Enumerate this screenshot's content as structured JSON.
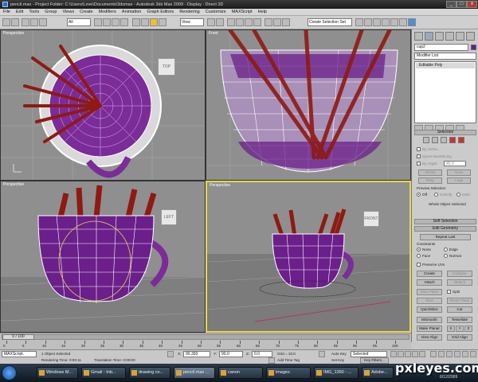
{
  "window": {
    "title": "pencil.max    - Project Folder: C:\\Users\\Love\\Documents\\3dsmax    - Autodesk 3ds Max 2009    - Display : Direct 3D",
    "buttons": [
      "_",
      "□",
      "x"
    ]
  },
  "menu": [
    "File",
    "Edit",
    "Tools",
    "Group",
    "Views",
    "Create",
    "Modifiers",
    "Animation",
    "Graph Editors",
    "Rendering",
    "Customize",
    "MAXScript",
    "Help"
  ],
  "toolbar": {
    "filter_value": "All",
    "refcoord_value": "View",
    "selection_set_placeholder": "Create Selection Set"
  },
  "viewports": [
    {
      "label": "Perspective",
      "cube": "TOP"
    },
    {
      "label": "Front"
    },
    {
      "label": "Perspective",
      "cube": "LEFT"
    },
    {
      "label": "Perspective",
      "cube": "FRONT"
    }
  ],
  "cmd": {
    "object_name": "cup2",
    "modifier_list": "Modifier List",
    "stack_item": "Editable Poly",
    "selection": {
      "header": "Selection",
      "by_vertex": "By Vertex",
      "ignore_backfacing": "Ignore Backfacing",
      "by_angle": "By Angle:",
      "angle_value": "45.0",
      "shrink": "Shrink",
      "grow": "Grow",
      "ring": "Ring",
      "loop": "Loop",
      "preview_selection": "Preview Selection",
      "preview_options": [
        "Off",
        "SubObj",
        "Multi"
      ],
      "status": "Whole Object Selected"
    },
    "soft_selection": "Soft Selection",
    "edit_geometry": {
      "header": "Edit Geometry",
      "repeat_last": "Repeat Last",
      "constraints": "Constraints",
      "none": "None",
      "edge": "Edge",
      "face": "Face",
      "normal": "Normal",
      "preserve_uvs": "Preserve UVs",
      "create": "Create",
      "collapse": "Collapse",
      "attach": "Attach",
      "detach": "Detach",
      "slice_plane": "Slice Plane",
      "split": "Split",
      "slice": "Slice",
      "reset_plane": "Reset Plane",
      "quickslice": "QuickSlice",
      "cut": "Cut",
      "msmooth": "MSmooth",
      "tessellate": "Tessellate",
      "make_planar": "Make Planar",
      "x": "X",
      "y": "Y",
      "z": "Z",
      "view_align": "View Align",
      "grid_align": "Grid Align"
    }
  },
  "timeline": {
    "frame_counter": "0 / 100",
    "ticks": [
      "0",
      "5",
      "10",
      "15",
      "20",
      "25",
      "30",
      "35",
      "40",
      "45",
      "50",
      "55",
      "60",
      "65",
      "70",
      "75",
      "80",
      "85",
      "90",
      "95",
      "100"
    ]
  },
  "status": {
    "maxscript": "MAXScript.",
    "selected": "1 Object Selected",
    "rendering_time": "Rendering Time: 0:00:11",
    "translation_time": "Translation Time: 0:00:00",
    "x_label": "X:",
    "x_value": "90.393",
    "y_label": "Y:",
    "y_value": "90.0",
    "z_label": "Z:",
    "z_value": "0.0",
    "grid": "Grid = 10.0",
    "add_time_tag": "Add Time Tag",
    "auto_key": "Auto Key",
    "set_key": "Set Key",
    "selected_dropdown": "Selected",
    "key_filters": "Key Filters..."
  },
  "taskbar": {
    "items": [
      "Windows M...",
      "Gmail - Inb...",
      "drawing co...",
      "pencil.max ...",
      "canon",
      "images",
      "IMG_1360 - ...",
      "Adobe..."
    ],
    "clock": "6/12/2009"
  },
  "watermark": "pxleyes.com",
  "colors": {
    "pencil_red": "#8e1a12",
    "cup_purple": "#6b1f8a",
    "active_border": "#e8d84a",
    "viewport_bg": "#8f8f8f"
  }
}
